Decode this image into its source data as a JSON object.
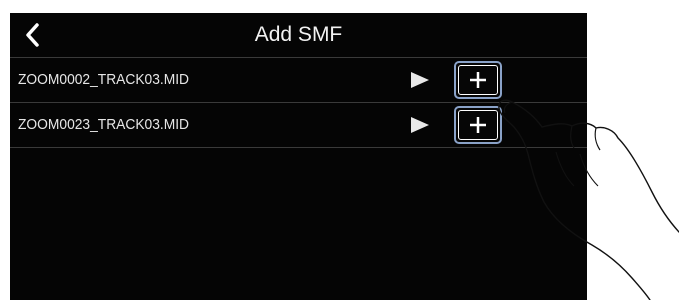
{
  "header": {
    "title": "Add SMF",
    "back_icon": "chevron-left-icon"
  },
  "files": [
    {
      "name": "ZOOM0002_TRACK03.MID"
    },
    {
      "name": "ZOOM0023_TRACK03.MID"
    }
  ],
  "icons": {
    "play": "play-icon",
    "add": "plus-icon"
  },
  "colors": {
    "background": "#050505",
    "text": "#e6e6e6",
    "highlight": "#8aa2c8"
  }
}
